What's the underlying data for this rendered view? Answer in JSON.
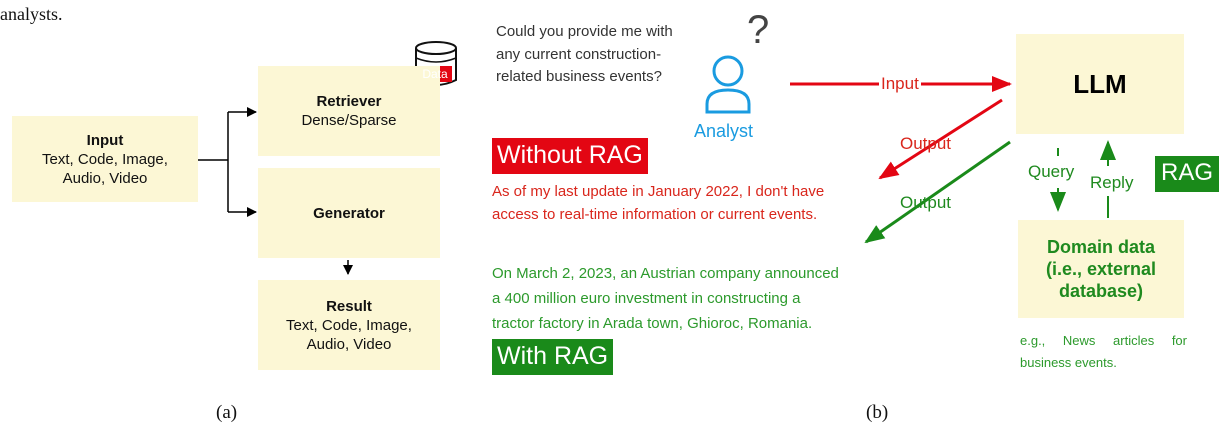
{
  "header": {
    "fragment": "analysts."
  },
  "panel_a": {
    "label": "(a)",
    "input": {
      "title": "Input",
      "line1": "Text, Code, Image,",
      "line2": "Audio, Video"
    },
    "retriever": {
      "title": "Retriever",
      "subtitle": "Dense/Sparse"
    },
    "data_icon_label": "Data",
    "generator": {
      "title": "Generator"
    },
    "result": {
      "title": "Result",
      "line1": "Text, Code, Image,",
      "line2": "Audio, Video"
    }
  },
  "panel_b": {
    "label": "(b)",
    "question": {
      "line1": "Could you provide me with",
      "line2": "any current construction-",
      "line3": "related business events?"
    },
    "question_mark": "?",
    "analyst_label": "Analyst",
    "input_arrow_label": "Input",
    "llm_label": "LLM",
    "output_label_red": "Output",
    "output_label_green": "Output",
    "without_rag": "Without RAG",
    "without_rag_text": {
      "line1": "As of my last update in January 2022, I don't have",
      "line2": "access to real-time information or current events."
    },
    "with_rag_text": {
      "line1": "On March 2, 2023, an Austrian company announced",
      "line2": "a 400 million euro investment in constructing a",
      "line3": "tractor factory in Arada town, Ghioroc, Romania."
    },
    "with_rag": "With RAG",
    "query_label": "Query",
    "reply_label": "Reply",
    "rag_badge": "RAG",
    "domain_data": {
      "line1": "Domain data",
      "line2": "(i.e., external",
      "line3": "database)"
    },
    "example_note": {
      "line1": "e.g., News articles for",
      "line2": "business events."
    }
  },
  "colors": {
    "box_fill": "#fcf7d5",
    "red": "#e30613",
    "green": "#1a8a1a",
    "analyst_blue": "#1a9be0"
  }
}
